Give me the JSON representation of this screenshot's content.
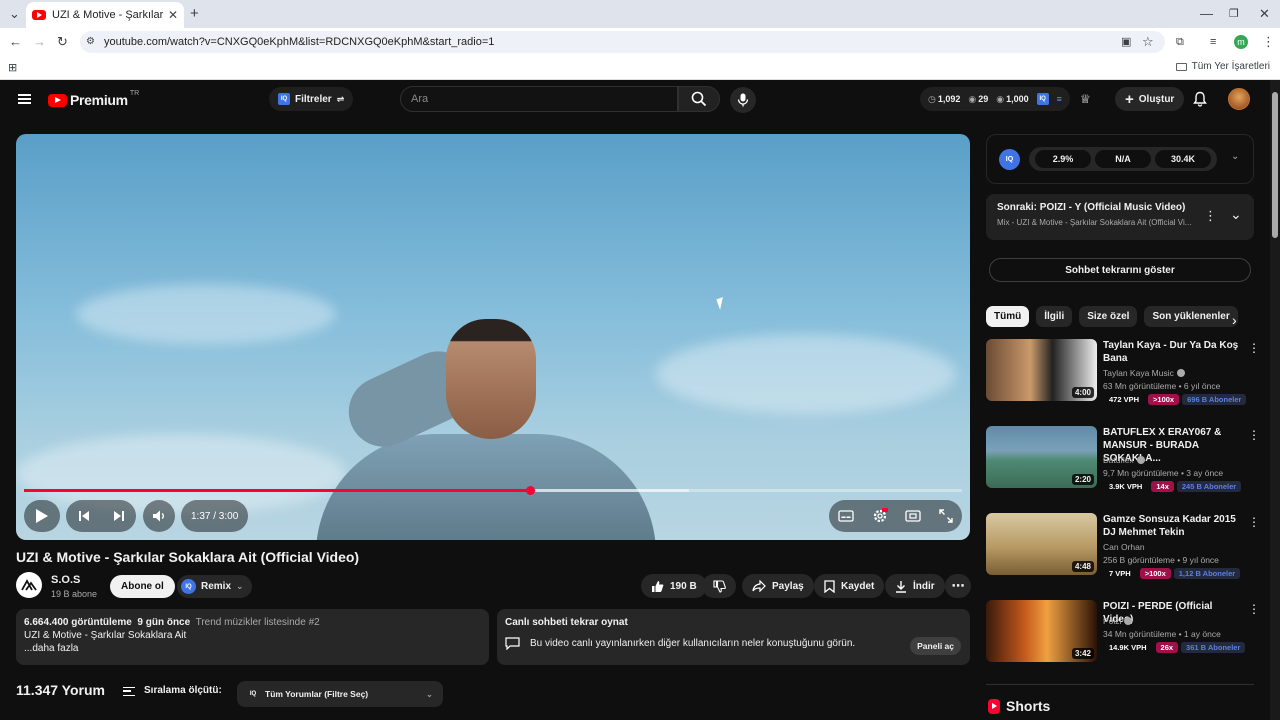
{
  "browser": {
    "tab_title": "UZI & Motive - Şarkılar Sokakla",
    "url": "youtube.com/watch?v=CNXGQ0eKphM&list=RDCNXGQ0eKphM&start_radio=1",
    "bookmarks_label": "Tüm Yer İşaretleri",
    "profile_letter": "m"
  },
  "header": {
    "logo_text": "Premium",
    "country_code": "TR",
    "filters_label": "Filtreler",
    "search_placeholder": "Ara",
    "stat_1": "1,092",
    "stat_2": "29",
    "stat_3": "1,000",
    "create_label": "Oluştur"
  },
  "player": {
    "time": "1:37 / 3:00",
    "progress_fraction": 0.539,
    "buffered_fraction": 0.709
  },
  "video": {
    "title": "UZI & Motive - Şarkılar Sokaklara Ait (Official Video)",
    "channel_name": "S.O.S",
    "channel_subs": "19 B abone",
    "subscribe_label": "Abone ol",
    "remix_label": "Remix",
    "likes": "190 B",
    "share_label": "Paylaş",
    "save_label": "Kaydet",
    "download_label": "İndir",
    "views": "6.664.400 görüntüleme",
    "age": "9 gün önce",
    "trend": "Trend müzikler listesinde #2",
    "desc_line": "UZI & Motive - Şarkılar Sokaklara Ait",
    "more": "...daha fazla"
  },
  "chat_replay": {
    "title": "Canlı sohbeti tekrar oynat",
    "text": "Bu video canlı yayınlanırken diğer kullanıcıların neler konuştuğunu görün.",
    "panel_button": "Paneli aç"
  },
  "comments": {
    "count": "11.347 Yorum",
    "sort_label": "Sıralama ölçütü:",
    "filter_label": "Tüm Yorumlar (Filtre Seç)"
  },
  "sidebar": {
    "iq_stats": [
      "2.9%",
      "N/A",
      "30.4K"
    ],
    "next_title": "Sonraki: POIZI - Y (Official Music Video)",
    "next_sub": "Mix - UZI & Motive - Şarkılar Sokaklara Ait (Official Vi...",
    "chat_replay_button": "Sohbet tekrarını göster",
    "chips": [
      "Tümü",
      "İlgili",
      "Size özel",
      "Son yüklenenler"
    ],
    "recs": [
      {
        "title": "Taylan Kaya - Dur Ya Da Koş Bana",
        "channel": "Taylan Kaya Music",
        "meta": "63 Mn görüntüleme • 6 yıl önce",
        "dur": "4:00",
        "b1": "472 VPH",
        "b2": ">100x",
        "b3": "696 B Aboneler"
      },
      {
        "title": "BATUFLEX X ERAY067 & MANSUR - BURADA SOKAKLA...",
        "channel": "Batuflex",
        "meta": "9,7 Mn görüntüleme • 3 ay önce",
        "dur": "2:20",
        "b1": "3.9K VPH",
        "b2": "14x",
        "b3": "245 B Aboneler"
      },
      {
        "title": "Gamze  Sonsuza Kadar 2015 DJ Mehmet Tekin",
        "channel": "Can Orhan",
        "meta": "256 B görüntüleme • 9 yıl önce",
        "dur": "4:48",
        "b1": "7 VPH",
        "b2": ">100x",
        "b3": "1,12 B Aboneler"
      },
      {
        "title": "POIZI - PERDE (Official Video)",
        "channel": "Poizi",
        "meta": "34 Mn görüntüleme • 1 ay önce",
        "dur": "3:42",
        "b1": "14.9K VPH",
        "b2": "26x",
        "b3": "361 B Aboneler"
      }
    ],
    "shorts_label": "Shorts"
  },
  "colors": {
    "accent": "#ff0033",
    "bg": "#0f0f0f",
    "iq_blue": "#3f74e6"
  }
}
